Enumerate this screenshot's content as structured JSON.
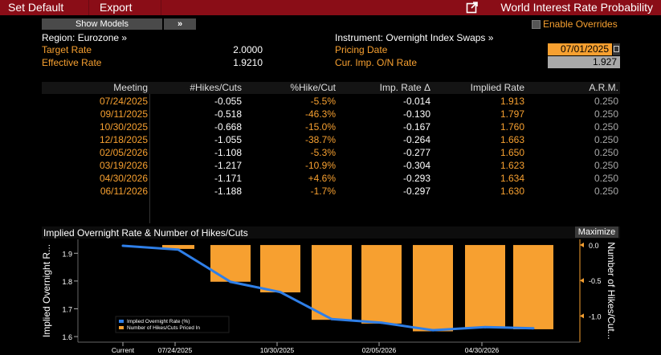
{
  "toolbar": {
    "set_default": "Set Default",
    "export": "Export",
    "title": "World Interest Rate Probability"
  },
  "subbar": {
    "show_models": "Show Models",
    "expand": "»",
    "enable_overrides": "Enable Overrides"
  },
  "info": {
    "region": "Region: Eurozone »",
    "target_rate_label": "Target Rate",
    "target_rate_value": "2.0000",
    "effective_rate_label": "Effective Rate",
    "effective_rate_value": "1.9210",
    "instrument": "Instrument: Overnight Index Swaps »",
    "pricing_date_label": "Pricing Date",
    "pricing_date_value": "07/01/2025",
    "cur_imp_label": "Cur. Imp. O/N Rate",
    "cur_imp_value": "1.927"
  },
  "table": {
    "headers": [
      "Meeting",
      "#Hikes/Cuts",
      "%Hike/Cut",
      "Imp. Rate Δ",
      "Implied Rate",
      "A.R.M."
    ],
    "rows": [
      {
        "meeting": "07/24/2025",
        "hikes": "-0.055",
        "pct": "-5.5%",
        "delta": "-0.014",
        "implied": "1.913",
        "arm": "0.250"
      },
      {
        "meeting": "09/11/2025",
        "hikes": "-0.518",
        "pct": "-46.3%",
        "delta": "-0.130",
        "implied": "1.797",
        "arm": "0.250"
      },
      {
        "meeting": "10/30/2025",
        "hikes": "-0.668",
        "pct": "-15.0%",
        "delta": "-0.167",
        "implied": "1.760",
        "arm": "0.250"
      },
      {
        "meeting": "12/18/2025",
        "hikes": "-1.055",
        "pct": "-38.7%",
        "delta": "-0.264",
        "implied": "1.663",
        "arm": "0.250"
      },
      {
        "meeting": "02/05/2026",
        "hikes": "-1.108",
        "pct": "-5.3%",
        "delta": "-0.277",
        "implied": "1.650",
        "arm": "0.250"
      },
      {
        "meeting": "03/19/2026",
        "hikes": "-1.217",
        "pct": "-10.9%",
        "delta": "-0.304",
        "implied": "1.623",
        "arm": "0.250"
      },
      {
        "meeting": "04/30/2026",
        "hikes": "-1.171",
        "pct": "+4.6%",
        "delta": "-0.293",
        "implied": "1.634",
        "arm": "0.250"
      },
      {
        "meeting": "06/11/2026",
        "hikes": "-1.188",
        "pct": "-1.7%",
        "delta": "-0.297",
        "implied": "1.630",
        "arm": "0.250"
      }
    ]
  },
  "chart": {
    "title": "Implied Overnight Rate & Number of Hikes/Cuts",
    "maximize": "Maximize"
  },
  "chart_data": {
    "type": "bar+line",
    "categories": [
      "Current",
      "07/24/2025",
      "09/11/2025",
      "10/30/2025",
      "12/18/2025",
      "02/05/2026",
      "03/19/2026",
      "04/30/2026",
      "06/11/2026"
    ],
    "series": [
      {
        "name": "Implied Overnight Rate (%)",
        "type": "line",
        "axis": "left",
        "values": [
          1.927,
          1.913,
          1.797,
          1.76,
          1.663,
          1.65,
          1.623,
          1.634,
          1.63
        ]
      },
      {
        "name": "Number of Hikes/Cuts Priced In",
        "type": "bar",
        "axis": "right",
        "values": [
          0,
          -0.055,
          -0.518,
          -0.668,
          -1.055,
          -1.108,
          -1.217,
          -1.171,
          -1.188
        ]
      }
    ],
    "x_tick_labels": [
      "Current",
      "07/24/2025",
      "10/30/2025",
      "02/05/2026",
      "04/30/2026"
    ],
    "ylabel_left": "Implied Overnight R...",
    "ylabel_right": "Number of Hikes/Cut...",
    "ylim_left": [
      1.58,
      1.95
    ],
    "yticks_left": [
      "1.9",
      "1.8",
      "1.7",
      "1.6"
    ],
    "ylim_right": [
      -1.37,
      0.08
    ],
    "yticks_right": [
      "0.0",
      "-0.5",
      "-1.0"
    ],
    "legend_position": "bottom-left",
    "colors": {
      "line": "#2f7fe8",
      "bar": "#f7a030",
      "background": "#000000"
    }
  }
}
